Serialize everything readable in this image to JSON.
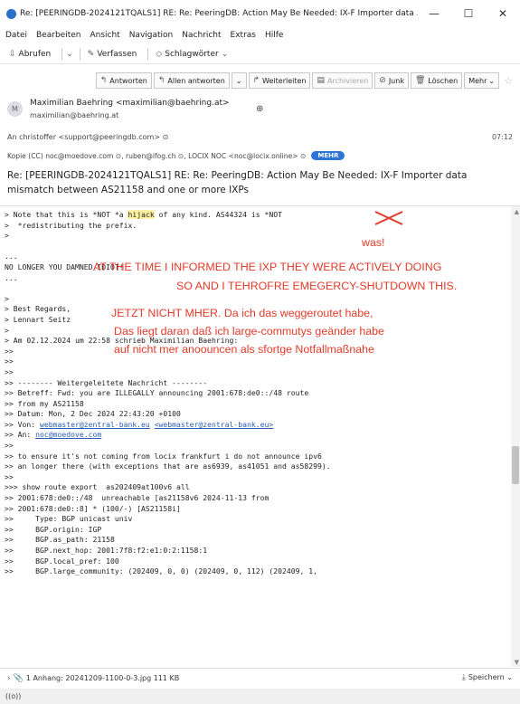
{
  "window": {
    "title": "Re: [PEERINGDB-2024121TQALS1] RE: Re: PeeringDB: Action May Be Needed: IX-F Importer data ...",
    "minimize": "—",
    "maximize": "☐",
    "close": "✕"
  },
  "menu": [
    "Datei",
    "Bearbeiten",
    "Ansicht",
    "Navigation",
    "Nachricht",
    "Extras",
    "Hilfe"
  ],
  "toolbar": {
    "abrufen": "Abrufen",
    "verfassen": "Verfassen",
    "schlagwoerter": "Schlagwörter"
  },
  "header_buttons": {
    "antworten": "Antworten",
    "allen_antworten": "Allen antworten",
    "weiterleiten": "Weiterleiten",
    "archivieren": "Archivieren",
    "junk": "Junk",
    "loeschen": "Löschen",
    "mehr": "Mehr"
  },
  "message": {
    "avatar": "M",
    "sender_name": "Maximilian Baehring <maximilian@baehring.at>",
    "sender_email": "maximilian@baehring.at",
    "to": "An  christoffer <support@peeringdb.com> ⊙",
    "time": "07:12",
    "cc": "Kopie (CC)  noc@moedove.com ⊙, ruben@ifog.ch ⊙, LOCIX NOC <noc@locix.online> ⊙",
    "cc_more": "MEHR",
    "subject": "Re: [PEERINGDB-2024121TQALS1] RE: Re: PeeringDB: Action May Be Needed: IX-F Importer data mismatch between AS21158 and one or more IXPs"
  },
  "body": {
    "l1a": "> Note that this is *NOT *a ",
    "l1_hl": "hijack",
    "l1b": " of any kind. AS44324 is *NOT",
    "l2": ">  *redistributing the prefix.",
    "l3": ">",
    "l4": "...",
    "l5": "NO LONGER YOU DAMNED IDIOT!",
    "l6": "...",
    "l7": ">",
    "l8": "> Best Regards,",
    "l9": "> Lennart Seitz",
    "l10": ">",
    "l11": "> Am 02.12.2024 um 22:58 schrieb Maximilian Baehring:",
    "l12": ">>",
    "l13": ">>",
    "l14": ">>",
    "l15": ">> -------- Weitergeleitete Nachricht --------",
    "l16": ">> Betreff: Fwd: you are ILLEGALLY announcing 2001:678:de0::/48 route",
    "l17": ">> from my AS21158",
    "l18": ">> Datum: Mon, 2 Dec 2024 22:43:20 +0100",
    "l19a": ">> Von: ",
    "l19_link1": "webmaster@zentral-bank.eu",
    "l19_link2": "<webmaster@zentral-bank.eu>",
    "l20a": ">> An: ",
    "l20_link": "noc@moedove.com",
    "l21": ">>",
    "l22": ">> to ensure it's not coming from locix frankfurt i do not announce ipv6",
    "l23": ">> an longer there (with exceptions that are as6939, as41051 and as58299).",
    "l24": ">>",
    "l25": ">>> show route export  as202409at100v6 all",
    "l26": ">> 2001:678:de0::/48  unreachable [as21158v6 2024-11-13 from",
    "l27": ">> 2001:678:de0::8] * (100/-) [AS21158i]",
    "l28": ">>     Type: BGP unicast univ",
    "l29": ">>     BGP.origin: IGP",
    "l30": ">>     BGP.as_path: 21158",
    "l31": ">>     BGP.next_hop: 2001:7f8:f2:e1:0:2:1158:1",
    "l32": ">>     BGP.local_pref: 100",
    "l33": ">>     BGP.large_community: (202409, 0, 0) (202409, 0, 112) (202409, 1,"
  },
  "annotations": {
    "was": "was!",
    "red1": "AT THE TIME I INFORMED THE IXP THEY WERE ACTIVELY DOING",
    "red2": "SO AND I TEHROFRE EMEGERCY-SHUTDOWN THIS.",
    "red3": "JETZT NICHT MHER. Da ich das weggeroutet habe,",
    "red4": "Das liegt daran daß ich large-commutys geänder habe",
    "red5": "auf nicht mer anoouncen als sfortge Notfallmaßnahe"
  },
  "attachment": {
    "label": "1 Anhang: 20241209-1100-0-3.jpg  111 KB",
    "save": "Speichern"
  },
  "status": "((o))",
  "colors": {
    "annotation_red": "#e23a2a",
    "accent_blue": "#2e74d8"
  }
}
